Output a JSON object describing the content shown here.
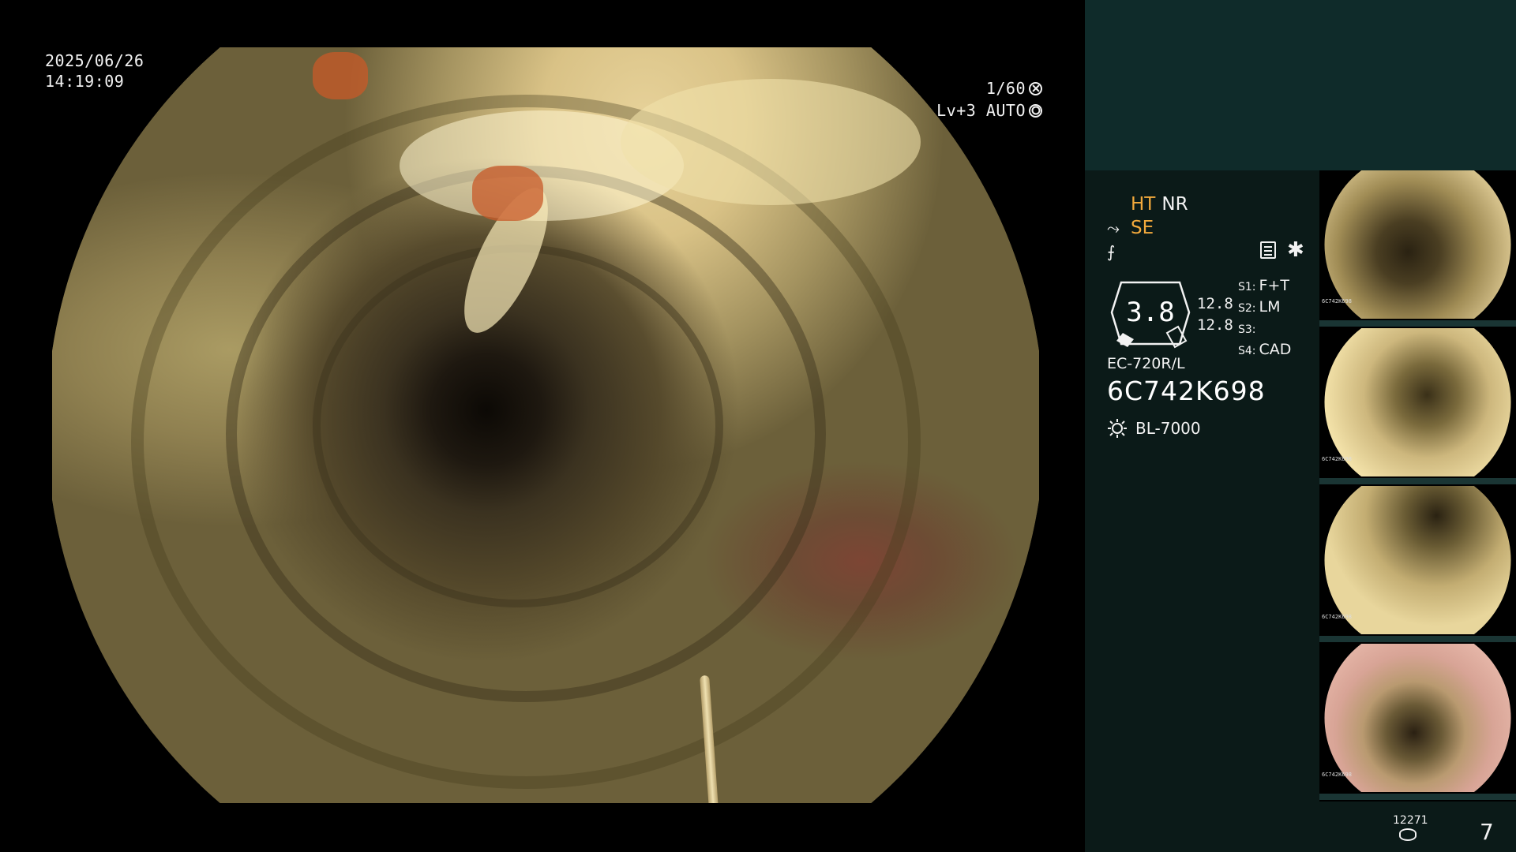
{
  "osd": {
    "date": "2025/06/26",
    "time": "14:19:09",
    "shutter": "1/60",
    "level": "Lv+3 AUTO"
  },
  "settings": {
    "ht": "HT",
    "nr": "NR",
    "se": "SE",
    "gauge_value": "3.8",
    "scale_top": "12.8",
    "scale_bottom": "12.8",
    "modes": [
      {
        "slot": "S1:",
        "value": "F+T"
      },
      {
        "slot": "S2:",
        "value": "LM"
      },
      {
        "slot": "S3:",
        "value": ""
      },
      {
        "slot": "S4:",
        "value": "CAD"
      }
    ],
    "scope_model": "EC-720R/L",
    "scope_serial": "6C742K698",
    "light_source": "BL-7000"
  },
  "thumbnails": [
    {
      "serial": "6C742K698",
      "tint": "dark"
    },
    {
      "serial": "6C742K698",
      "tint": "bright"
    },
    {
      "serial": "6C742K698",
      "tint": "bright"
    },
    {
      "serial": "6C742K698",
      "tint": "pink"
    }
  ],
  "footer": {
    "image_count": "12271",
    "page": "7"
  },
  "icons": {
    "shutter": "shutter-icon",
    "auto": "auto-iris-icon",
    "doc": "document-icon",
    "star": "asterisk-icon",
    "light": "light-source-icon",
    "storage": "storage-disk-icon"
  },
  "colors": {
    "active_flag": "#f2a93c",
    "panel_bg": "#0b1a18",
    "info_band": "#0f2b2a"
  }
}
